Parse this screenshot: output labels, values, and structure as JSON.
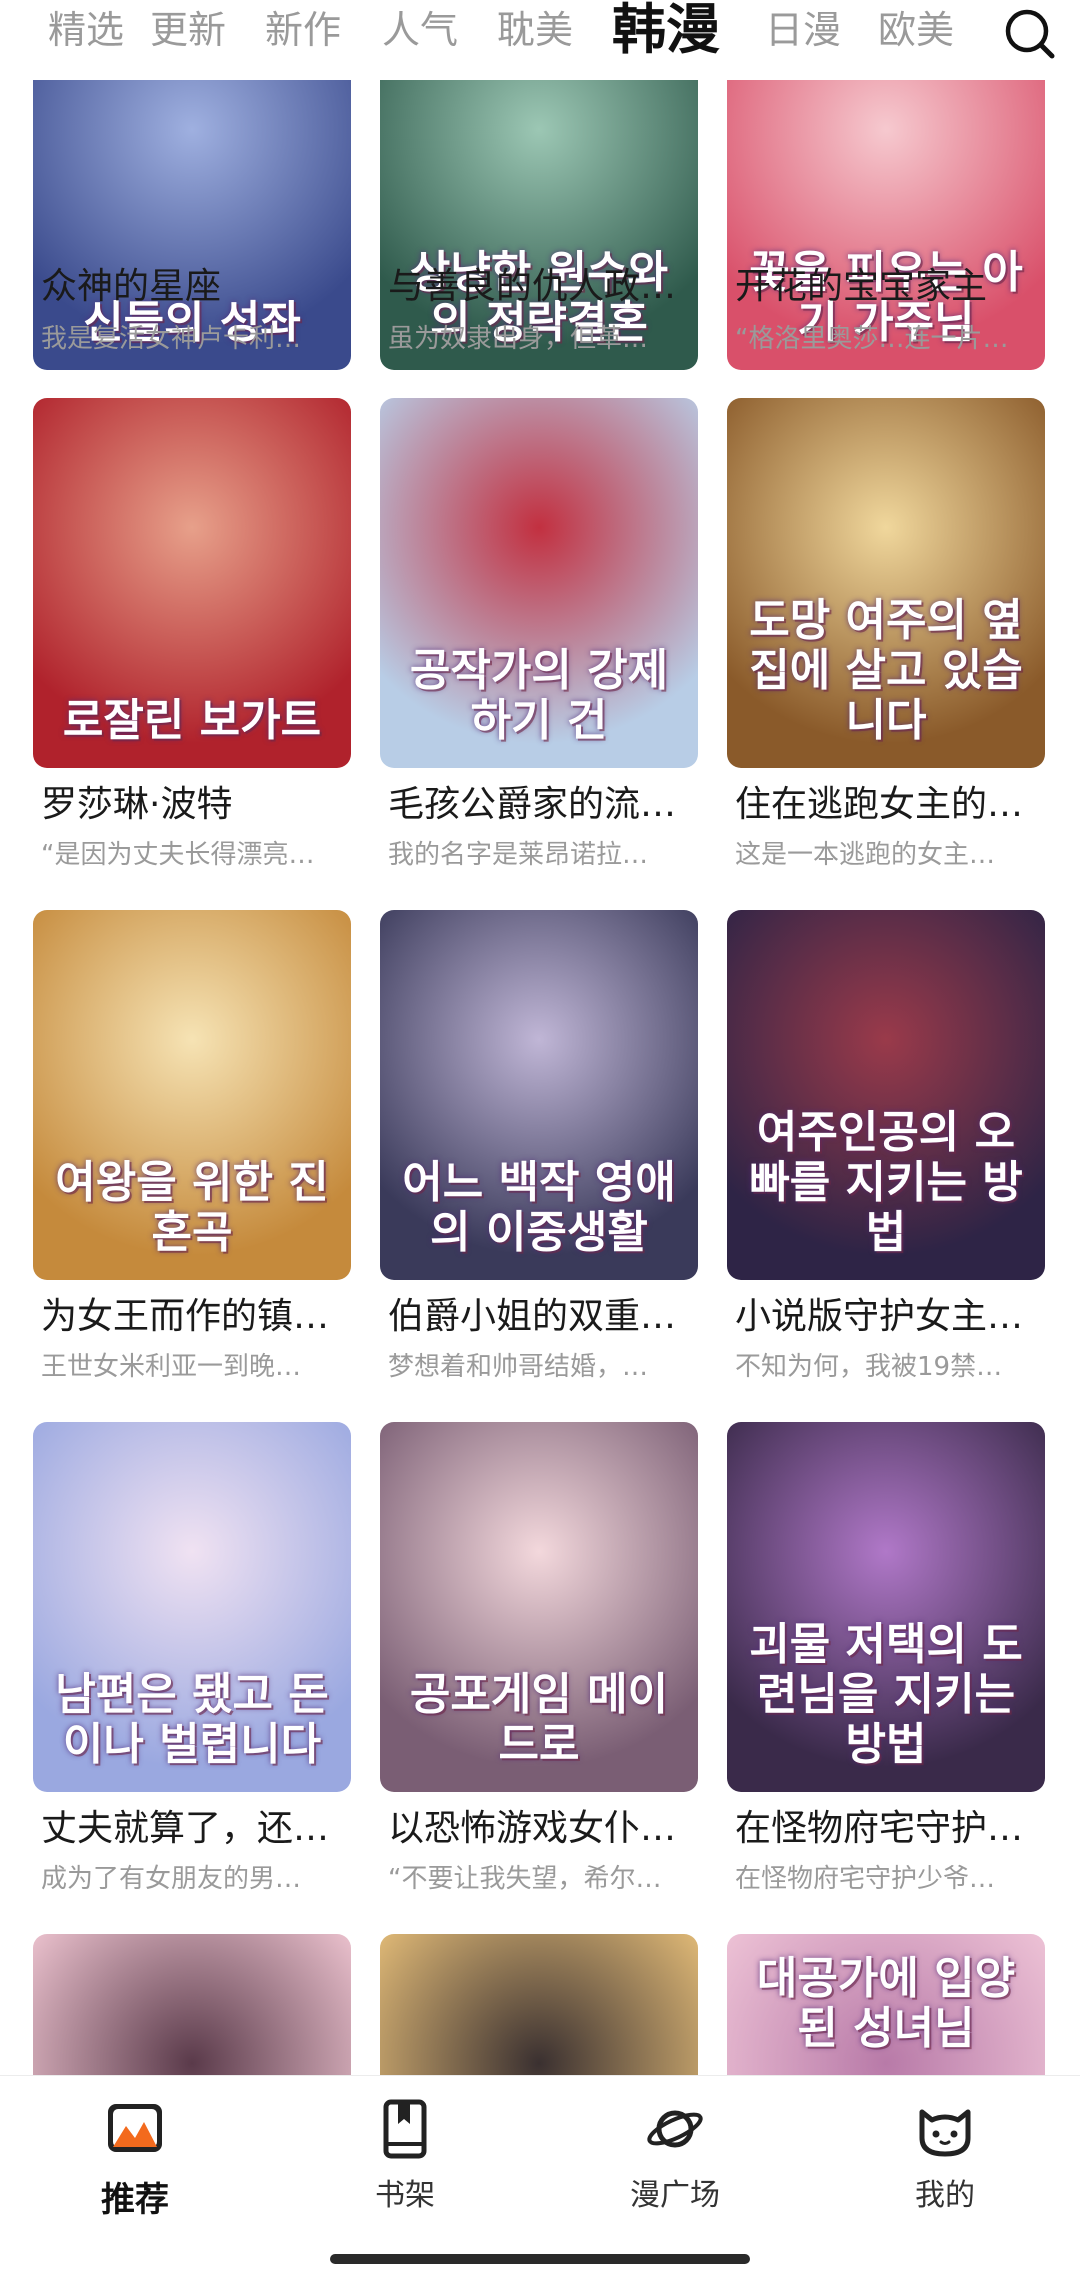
{
  "tabs": [
    {
      "label": "精选",
      "active": false
    },
    {
      "label": "更新",
      "active": false
    },
    {
      "label": "新作",
      "active": false
    },
    {
      "label": "人气",
      "active": false
    },
    {
      "label": "耽美",
      "active": false
    },
    {
      "label": "韩漫",
      "active": true
    },
    {
      "label": "日漫",
      "active": false
    },
    {
      "label": "欧美",
      "active": false
    }
  ],
  "search_icon": "search-icon",
  "comics": [
    {
      "title": "众神的星座",
      "desc": "我是复活女神卢卡利…",
      "cover_text": "신들의 성좌",
      "colors": [
        "#3a4a8c",
        "#9fb0e0"
      ]
    },
    {
      "title": "与善良的仇人政…",
      "desc": "虽为奴隶出身，但革…",
      "cover_text": "상냥한 원수와의 정략결혼",
      "colors": [
        "#2f5a4c",
        "#9cc7b4"
      ]
    },
    {
      "title": "开花的宝宝家主",
      "desc": "“格洛里奥莎…连一片…",
      "cover_text": "꽃을 피우는 아기 가주님",
      "colors": [
        "#d9506a",
        "#f6c9cf"
      ]
    },
    {
      "title": "罗莎琳·波特",
      "desc": "“是因为丈夫长得漂亮…",
      "cover_text": "로잘린 보가트",
      "colors": [
        "#b0222c",
        "#e7a08a"
      ]
    },
    {
      "title": "毛孩公爵家的流…",
      "desc": "我的名字是莱昂诺拉…",
      "cover_text": "공작가의 강제 하기 건",
      "colors": [
        "#b8cde6",
        "#c23040"
      ]
    },
    {
      "title": "住在逃跑女主的…",
      "desc": "这是一本逃跑的女主…",
      "cover_text": "도망 여주의 옆집에 살고 있습니다",
      "colors": [
        "#8a5a2a",
        "#f0d79c"
      ]
    },
    {
      "title": "为女王而作的镇…",
      "desc": "王世女米利亚一到晚…",
      "cover_text": "여왕을 위한 진혼곡",
      "colors": [
        "#c58a3c",
        "#f6e3b4"
      ]
    },
    {
      "title": "伯爵小姐的双重…",
      "desc": "梦想着和帅哥结婚，…",
      "cover_text": "어느 백작 영애의 이중생활",
      "colors": [
        "#3a3a5a",
        "#c0b6d6"
      ]
    },
    {
      "title": "小说版守护女主…",
      "desc": "不知为何，我被19禁…",
      "cover_text": "여주인공의 오빠를 지키는 방법",
      "colors": [
        "#2e2446",
        "#9a3a4a"
      ]
    },
    {
      "title": "丈夫就算了，还…",
      "desc": "成为了有女朋友的男…",
      "cover_text": "남편은 됐고 돈이나 벌렵니다",
      "colors": [
        "#9aa8e0",
        "#f0e2f2"
      ]
    },
    {
      "title": "以恐怖游戏女仆…",
      "desc": "“不要让我失望，希尔…",
      "cover_text": "공포게임 메이드로",
      "colors": [
        "#7a5e74",
        "#f3d8dc"
      ]
    },
    {
      "title": "在怪物府宅守护…",
      "desc": "在怪物府宅守护少爷…",
      "cover_text": "괴물 저택의 도련님을 지키는 방법",
      "colors": [
        "#3a2a4a",
        "#b078c8"
      ]
    },
    {
      "title": "",
      "desc": "",
      "cover_text": "",
      "colors": [
        "#f2c8d4",
        "#5a3a4a"
      ]
    },
    {
      "title": "",
      "desc": "",
      "cover_text": "",
      "colors": [
        "#e8c07a",
        "#3a3030"
      ]
    },
    {
      "title": "",
      "desc": "",
      "cover_text": "대공가에 입양된 성녀님",
      "colors": [
        "#f0c6d8",
        "#b87aa8"
      ]
    }
  ],
  "bottom_nav": [
    {
      "label": "推荐",
      "icon": "recommend-icon",
      "active": true
    },
    {
      "label": "书架",
      "icon": "bookshelf-icon",
      "active": false
    },
    {
      "label": "漫广场",
      "icon": "planet-icon",
      "active": false
    },
    {
      "label": "我的",
      "icon": "cat-face-icon",
      "active": false
    }
  ]
}
